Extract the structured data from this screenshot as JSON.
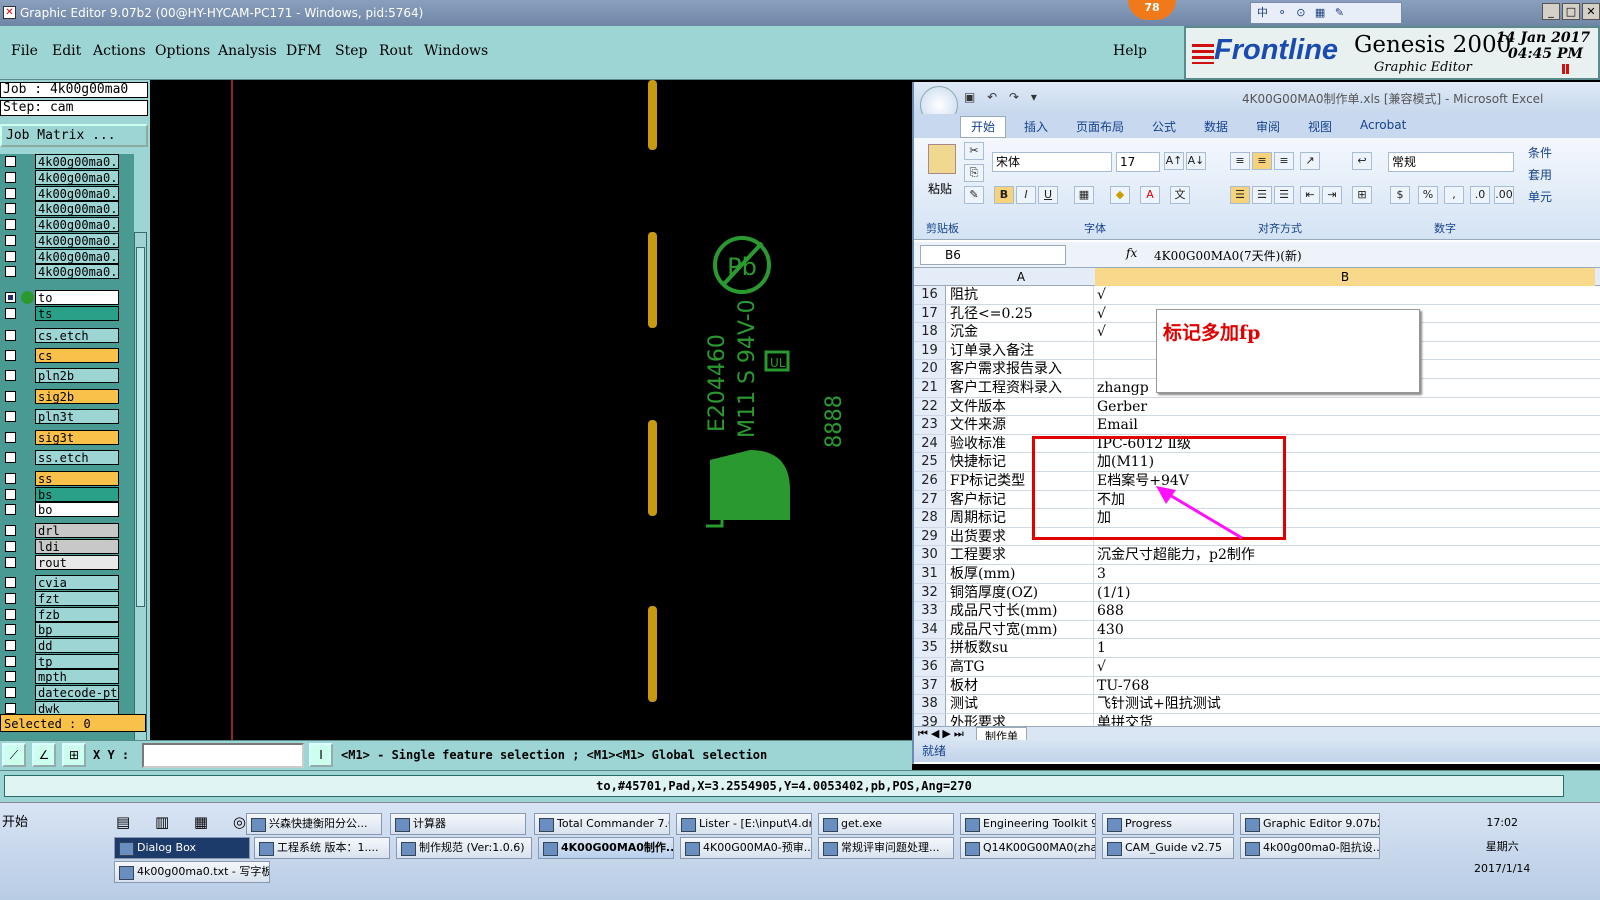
{
  "window": {
    "title": "Graphic Editor 9.07b2 (00@HY-HYCAM-PC171 - Windows, pid:5764)",
    "badge": "78",
    "ime": "中 ⚬ ⊙ ▦ ✎"
  },
  "menu": [
    "File",
    "Edit",
    "Actions",
    "Options",
    "Analysis",
    "DFM",
    "Step",
    "Rout",
    "Windows"
  ],
  "help": "Help",
  "brand": {
    "logo": "Frontline",
    "product": "Genesis 2000",
    "subtitle": "Graphic Editor",
    "date": "14 Jan 2017",
    "time": "04:45 PM"
  },
  "job": {
    "job": "Job  : 4k00g00ma0",
    "step": "Step: cam",
    "matrix": "Job Matrix ...",
    "selected": "Selected : 0"
  },
  "layers": [
    {
      "name": "4k00g00ma0.c",
      "color": "#9cd5d3"
    },
    {
      "name": "4k00g00ma0.c",
      "color": "#9cd5d3"
    },
    {
      "name": "4k00g00ma0.c",
      "color": "#9cd5d3"
    },
    {
      "name": "4k00g00ma0.c",
      "color": "#9cd5d3"
    },
    {
      "name": "4k00g00ma0.c",
      "color": "#9cd5d3"
    },
    {
      "name": "4k00g00ma0.c",
      "color": "#9cd5d3"
    },
    {
      "name": "4k00g00ma0.c",
      "color": "#9cd5d3"
    },
    {
      "name": "4k00g00ma0.c",
      "color": "#9cd5d3"
    },
    {
      "name": "to",
      "color": "#ffffff",
      "active": true
    },
    {
      "name": "ts",
      "color": "#2aa088"
    },
    {
      "name": "cs.etch",
      "color": "#9cd5d3"
    },
    {
      "name": "cs",
      "color": "#f9c04a"
    },
    {
      "name": "pln2b",
      "color": "#9cd5d3"
    },
    {
      "name": "sig2b",
      "color": "#f9c04a"
    },
    {
      "name": "pln3t",
      "color": "#9cd5d3"
    },
    {
      "name": "sig3t",
      "color": "#f9c04a"
    },
    {
      "name": "ss.etch",
      "color": "#9cd5d3"
    },
    {
      "name": "ss",
      "color": "#f9c04a"
    },
    {
      "name": "bs",
      "color": "#2aa088"
    },
    {
      "name": "bo",
      "color": "#ffffff"
    },
    {
      "name": "drl",
      "color": "#c8c8c8"
    },
    {
      "name": "ldi",
      "color": "#c8c8c8"
    },
    {
      "name": "rout",
      "color": "#e8e8e8"
    },
    {
      "name": "cvia",
      "color": "#9cd5d3"
    },
    {
      "name": "fzt",
      "color": "#9cd5d3"
    },
    {
      "name": "fzb",
      "color": "#9cd5d3"
    },
    {
      "name": "bp",
      "color": "#9cd5d3"
    },
    {
      "name": "dd",
      "color": "#9cd5d3"
    },
    {
      "name": "tp",
      "color": "#9cd5d3"
    },
    {
      "name": "mpth",
      "color": "#9cd5d3"
    },
    {
      "name": "datecode-pt",
      "color": "#9cd5d3"
    },
    {
      "name": "dwk",
      "color": "#9cd5d3"
    }
  ],
  "canvas": {
    "ul": "E204460",
    "marking": "M11 S 94V-0",
    "date": "8888",
    "pb": "Pb"
  },
  "excel": {
    "title": "4K00G00MA0制作单.xls [兼容模式] - Microsoft Excel",
    "tabs": [
      "开始",
      "插入",
      "页面布局",
      "公式",
      "数据",
      "审阅",
      "视图",
      "Acrobat"
    ],
    "font": "宋体",
    "size": "17",
    "numfmt": "常规",
    "paste": "粘贴",
    "groups": [
      "剪贴板",
      "字体",
      "对齐方式",
      "数字"
    ],
    "side": [
      "条件",
      "套用",
      "单元"
    ],
    "cellref": "B6",
    "formula": "4K00G00MA0(7天件)(新)",
    "colA": "A",
    "colB": "B",
    "rows": [
      {
        "n": "16",
        "a": "阻抗",
        "b": "√"
      },
      {
        "n": "17",
        "a": "孔径<=0.25",
        "b": "√"
      },
      {
        "n": "18",
        "a": "沉金",
        "b": "√"
      },
      {
        "n": "19",
        "a": "订单录入备注",
        "b": ""
      },
      {
        "n": "20",
        "a": "客户需求报告录入",
        "b": ""
      },
      {
        "n": "21",
        "a": "客户工程资料录入",
        "b": "zhangp"
      },
      {
        "n": "22",
        "a": "文件版本",
        "b": "Gerber"
      },
      {
        "n": "23",
        "a": "文件来源",
        "b": "Email"
      },
      {
        "n": "24",
        "a": "验收标准",
        "b": "IPC-6012 Ⅱ级"
      },
      {
        "n": "25",
        "a": "快捷标记",
        "b": "加(M11)"
      },
      {
        "n": "26",
        "a": "FP标记类型",
        "b": "E档案号+94V"
      },
      {
        "n": "27",
        "a": "客户标记",
        "b": "不加"
      },
      {
        "n": "28",
        "a": "周期标记",
        "b": "加"
      },
      {
        "n": "29",
        "a": "出货要求",
        "b": ""
      },
      {
        "n": "30",
        "a": "工程要求",
        "b": "沉金尺寸超能力，p2制作"
      },
      {
        "n": "31",
        "a": "板厚(mm)",
        "b": "3"
      },
      {
        "n": "32",
        "a": "铜箔厚度(OZ)",
        "b": "(1/1)"
      },
      {
        "n": "33",
        "a": "成品尺寸长(mm)",
        "b": "688"
      },
      {
        "n": "34",
        "a": "成品尺寸宽(mm)",
        "b": "430"
      },
      {
        "n": "35",
        "a": "拼板数su",
        "b": "1"
      },
      {
        "n": "36",
        "a": "高TG",
        "b": "√"
      },
      {
        "n": "37",
        "a": "板材",
        "b": "TU-768"
      },
      {
        "n": "38",
        "a": "测试",
        "b": "飞针测试+阻抗测试"
      },
      {
        "n": "39",
        "a": "外形要求",
        "b": "单拼交货"
      }
    ],
    "comment": "标记多加fp",
    "sheet": "制作单",
    "status": "就绪"
  },
  "cmd": {
    "xy": "X Y :",
    "hint": "<M1> - Single feature selection ; <M1><M1> Global selection"
  },
  "feature": "to,#45701,Pad,X=3.2554905,Y=4.0053402,pb,POS,Ang=270",
  "taskbar": {
    "start": "开始",
    "row1": [
      "兴森快捷衡阳分公...",
      "计算器",
      "Total Commander 7.0...",
      "Lister - [E:\\input\\4.drl]",
      "get.exe",
      "Engineering Toolkit 9....",
      "Progress",
      "Graphic Editor 9.07b2..."
    ],
    "row2": [
      "Dialog Box",
      "工程系统  版本：1....",
      "制作规范 (Ver:1.0.6)",
      "4K00G00MA0制作...",
      "4K00G00MA0-预审...",
      "常规评审问题处理...",
      "Q14K00G00MA0(zha...",
      "CAM_Guide v2.75",
      "4k00g00ma0-阻抗设..."
    ],
    "row3": [
      "4k00g00ma0.txt - 写字板"
    ],
    "time": "17:02",
    "weekday": "星期六",
    "date": "2017/1/14"
  }
}
